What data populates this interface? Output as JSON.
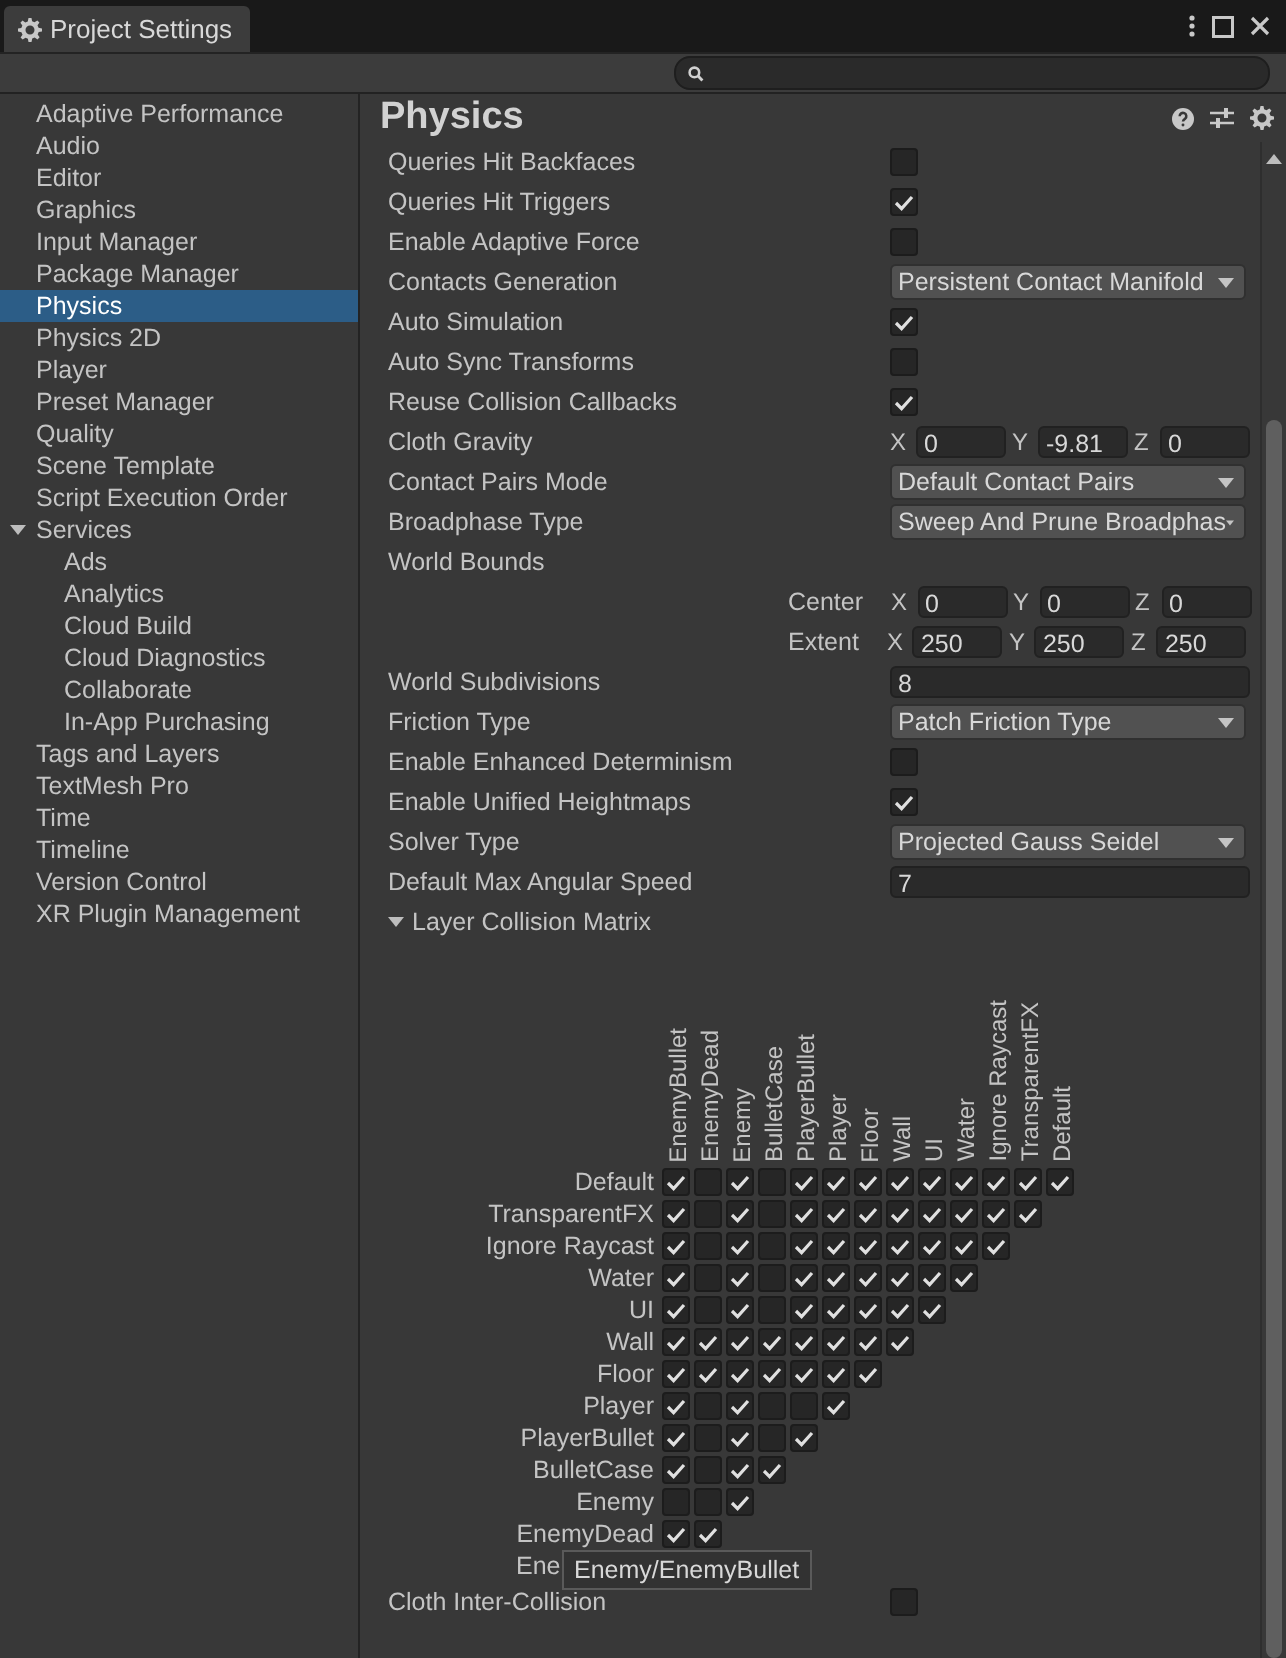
{
  "window": {
    "title": "Project Settings"
  },
  "sidebar": {
    "items": [
      {
        "label": "Adaptive Performance",
        "selected": false
      },
      {
        "label": "Audio",
        "selected": false
      },
      {
        "label": "Editor",
        "selected": false
      },
      {
        "label": "Graphics",
        "selected": false
      },
      {
        "label": "Input Manager",
        "selected": false
      },
      {
        "label": "Package Manager",
        "selected": false
      },
      {
        "label": "Physics",
        "selected": true
      },
      {
        "label": "Physics 2D",
        "selected": false
      },
      {
        "label": "Player",
        "selected": false
      },
      {
        "label": "Preset Manager",
        "selected": false
      },
      {
        "label": "Quality",
        "selected": false
      },
      {
        "label": "Scene Template",
        "selected": false
      },
      {
        "label": "Script Execution Order",
        "selected": false
      },
      {
        "label": "Services",
        "selected": false,
        "expanded": true,
        "children": [
          {
            "label": "Ads",
            "selected": false
          },
          {
            "label": "Analytics",
            "selected": false
          },
          {
            "label": "Cloud Build",
            "selected": false
          },
          {
            "label": "Cloud Diagnostics",
            "selected": false
          },
          {
            "label": "Collaborate",
            "selected": false
          },
          {
            "label": "In-App Purchasing",
            "selected": false
          }
        ]
      },
      {
        "label": "Tags and Layers",
        "selected": false
      },
      {
        "label": "TextMesh Pro",
        "selected": false
      },
      {
        "label": "Time",
        "selected": false
      },
      {
        "label": "Timeline",
        "selected": false
      },
      {
        "label": "Version Control",
        "selected": false
      },
      {
        "label": "XR Plugin Management",
        "selected": false
      }
    ]
  },
  "panel": {
    "title": "Physics",
    "settings": [
      {
        "kind": "checkbox",
        "label": "Queries Hit Backfaces",
        "checked": false
      },
      {
        "kind": "checkbox",
        "label": "Queries Hit Triggers",
        "checked": true
      },
      {
        "kind": "checkbox",
        "label": "Enable Adaptive Force",
        "checked": false
      },
      {
        "kind": "dropdown",
        "label": "Contacts Generation",
        "value": "Persistent Contact Manifold"
      },
      {
        "kind": "checkbox",
        "label": "Auto Simulation",
        "checked": true
      },
      {
        "kind": "checkbox",
        "label": "Auto Sync Transforms",
        "checked": false
      },
      {
        "kind": "checkbox",
        "label": "Reuse Collision Callbacks",
        "checked": true
      },
      {
        "kind": "vector",
        "label": "Cloth Gravity",
        "parts": [
          {
            "axis": "X",
            "value": "0"
          },
          {
            "axis": "Y",
            "value": "-9.81"
          },
          {
            "axis": "Z",
            "value": "0"
          }
        ]
      },
      {
        "kind": "dropdown",
        "label": "Contact Pairs Mode",
        "value": "Default Contact Pairs"
      },
      {
        "kind": "dropdown",
        "label": "Broadphase Type",
        "value": "Sweep And Prune Broadphas"
      },
      {
        "kind": "heading",
        "label": "World Bounds"
      },
      {
        "kind": "subvector",
        "label": "Center",
        "parts": [
          {
            "axis": "X",
            "value": "0"
          },
          {
            "axis": "Y",
            "value": "0"
          },
          {
            "axis": "Z",
            "value": "0"
          }
        ]
      },
      {
        "kind": "subvector",
        "label": "Extent",
        "parts": [
          {
            "axis": "X",
            "value": "250"
          },
          {
            "axis": "Y",
            "value": "250"
          },
          {
            "axis": "Z",
            "value": "250"
          }
        ]
      },
      {
        "kind": "number",
        "label": "World Subdivisions",
        "value": "8"
      },
      {
        "kind": "dropdown",
        "label": "Friction Type",
        "value": "Patch Friction Type"
      },
      {
        "kind": "checkbox",
        "label": "Enable Enhanced Determinism",
        "checked": false
      },
      {
        "kind": "checkbox",
        "label": "Enable Unified Heightmaps",
        "checked": true
      },
      {
        "kind": "dropdown",
        "label": "Solver Type",
        "value": "Projected Gauss Seidel"
      },
      {
        "kind": "number",
        "label": "Default Max Angular Speed",
        "value": "7"
      }
    ],
    "matrix": {
      "title": "Layer Collision Matrix",
      "expanded": true,
      "columns": [
        "EnemyBullet",
        "EnemyDead",
        "Enemy",
        "BulletCase",
        "PlayerBullet",
        "Player",
        "Floor",
        "Wall",
        "UI",
        "Water",
        "Ignore Raycast",
        "TransparentFX",
        "Default"
      ],
      "rows": [
        {
          "label": "Default",
          "cells": [
            true,
            false,
            true,
            false,
            true,
            true,
            true,
            true,
            true,
            true,
            true,
            true,
            true
          ]
        },
        {
          "label": "TransparentFX",
          "cells": [
            true,
            false,
            true,
            false,
            true,
            true,
            true,
            true,
            true,
            true,
            true,
            true
          ]
        },
        {
          "label": "Ignore Raycast",
          "cells": [
            true,
            false,
            true,
            false,
            true,
            true,
            true,
            true,
            true,
            true,
            true
          ]
        },
        {
          "label": "Water",
          "cells": [
            true,
            false,
            true,
            false,
            true,
            true,
            true,
            true,
            true,
            true
          ]
        },
        {
          "label": "UI",
          "cells": [
            true,
            false,
            true,
            false,
            true,
            true,
            true,
            true,
            true
          ]
        },
        {
          "label": "Wall",
          "cells": [
            true,
            true,
            true,
            true,
            true,
            true,
            true,
            true
          ]
        },
        {
          "label": "Floor",
          "cells": [
            true,
            true,
            true,
            true,
            true,
            true,
            true
          ]
        },
        {
          "label": "Player",
          "cells": [
            true,
            false,
            true,
            false,
            false,
            true
          ]
        },
        {
          "label": "PlayerBullet",
          "cells": [
            true,
            false,
            true,
            false,
            true
          ]
        },
        {
          "label": "BulletCase",
          "cells": [
            true,
            false,
            true,
            true
          ]
        },
        {
          "label": "Enemy",
          "cells": [
            false,
            false,
            true
          ]
        },
        {
          "label": "EnemyDead",
          "cells": [
            true,
            true
          ]
        },
        {
          "label": "Ene"
        }
      ],
      "tooltip": "Enemy/EnemyBullet"
    },
    "footer": {
      "kind": "checkbox",
      "label": "Cloth Inter-Collision",
      "checked": false
    }
  }
}
